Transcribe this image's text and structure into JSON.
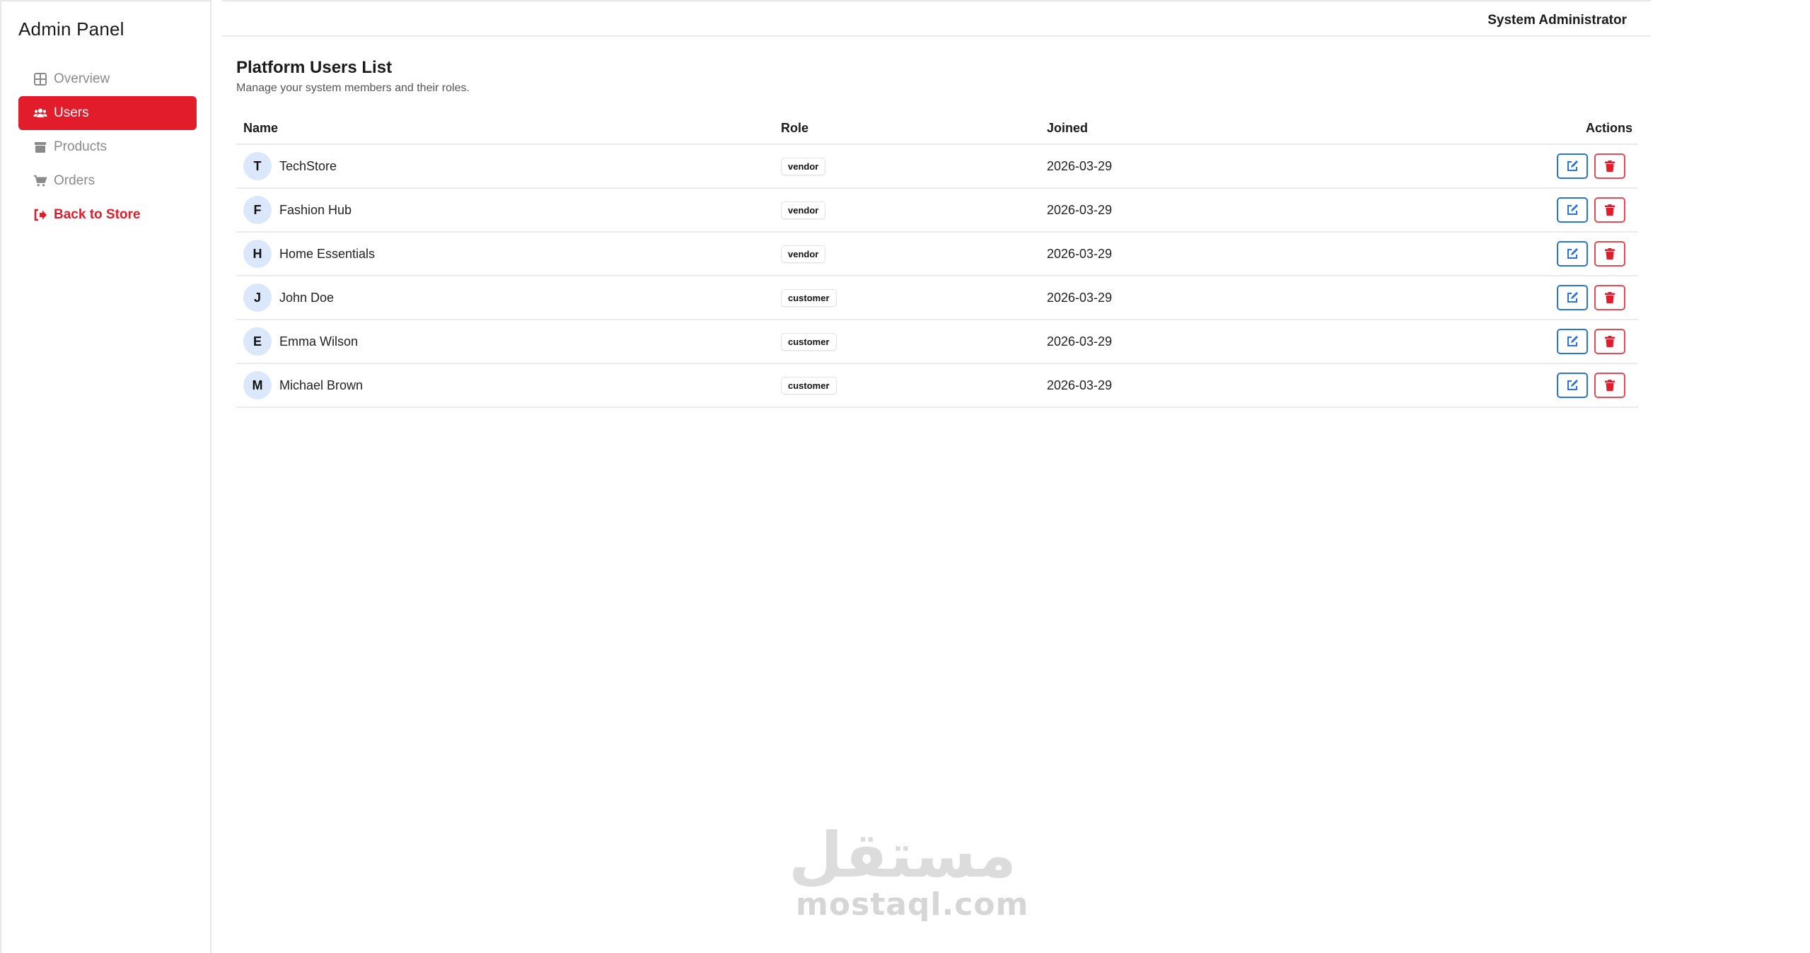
{
  "sidebar": {
    "brand": "Admin Panel",
    "items": [
      {
        "label": "Overview",
        "icon": "grid-icon",
        "active": false
      },
      {
        "label": "Users",
        "icon": "users-icon",
        "active": true
      },
      {
        "label": "Products",
        "icon": "box-icon",
        "active": false
      },
      {
        "label": "Orders",
        "icon": "cart-icon",
        "active": false
      }
    ],
    "back_label": "Back to Store",
    "back_icon": "sign-out-icon"
  },
  "header": {
    "user_name": "System Administrator"
  },
  "main": {
    "title": "Platform Users List",
    "subtitle": "Manage your system members and their roles.",
    "table": {
      "columns": {
        "name": "Name",
        "role": "Role",
        "joined": "Joined",
        "actions": "Actions"
      },
      "rows": [
        {
          "initial": "T",
          "name": "TechStore",
          "role": "vendor",
          "joined": "2026-03-29"
        },
        {
          "initial": "F",
          "name": "Fashion Hub",
          "role": "vendor",
          "joined": "2026-03-29"
        },
        {
          "initial": "H",
          "name": "Home Essentials",
          "role": "vendor",
          "joined": "2026-03-29"
        },
        {
          "initial": "J",
          "name": "John Doe",
          "role": "customer",
          "joined": "2026-03-29"
        },
        {
          "initial": "E",
          "name": "Emma Wilson",
          "role": "customer",
          "joined": "2026-03-29"
        },
        {
          "initial": "M",
          "name": "Michael Brown",
          "role": "customer",
          "joined": "2026-03-29"
        }
      ]
    }
  },
  "watermark": {
    "arabic": "مستقل",
    "latin": "mostaql.com"
  },
  "colors": {
    "accent": "#e31c2c",
    "edit": "#2a73d8",
    "delete": "#e24a55",
    "avatar_bg": "#dbe8fc"
  }
}
